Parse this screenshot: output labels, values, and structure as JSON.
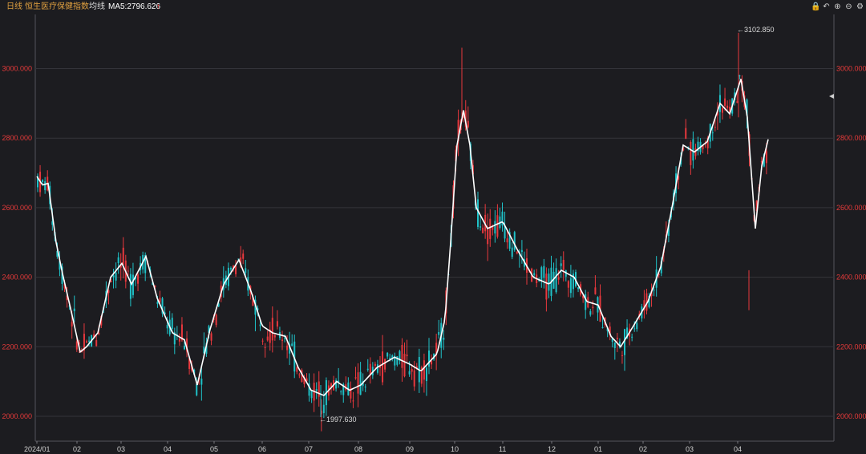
{
  "header": {
    "period_label": "日线",
    "index_name": "恒生医疗保健指数",
    "ma_label": "均线",
    "ma_text": "MA5:2796.626",
    "ma_arrow": "↑"
  },
  "controls": [
    {
      "name": "lock-icon",
      "glyph": "🔒"
    },
    {
      "name": "undo-icon",
      "glyph": "↶"
    },
    {
      "name": "zoom-in-icon",
      "glyph": "⊕"
    },
    {
      "name": "zoom-out-icon",
      "glyph": "⊖"
    },
    {
      "name": "settings-icon",
      "glyph": "⚙"
    }
  ],
  "chart_data": {
    "type": "candlestick",
    "title": "恒生医疗保健指数",
    "ylim": [
      1960,
      3140
    ],
    "y_ticks": [
      2000,
      2200,
      2400,
      2600,
      2800,
      3000
    ],
    "y_tick_labels": [
      "2000.000",
      "2200.000",
      "2400.000",
      "2600.000",
      "2800.000",
      "3000.000"
    ],
    "x_tick_labels": [
      "2024/01",
      "02",
      "03",
      "04",
      "05",
      "06",
      "07",
      "08",
      "09",
      "10",
      "11",
      "12",
      "01",
      "02",
      "03",
      "04"
    ],
    "annotations": [
      {
        "text": "←3102.850",
        "value": 3102.85,
        "kind": "high"
      },
      {
        "text": "←1997.630",
        "value": 1997.63,
        "kind": "low"
      }
    ],
    "ma_line_approx": [
      {
        "month": "2024/01",
        "value": 2690
      },
      {
        "month": "2024/01 end",
        "value": 2190
      },
      {
        "month": "2024/02 end",
        "value": 2450
      },
      {
        "month": "2024/03 end",
        "value": 2230
      },
      {
        "month": "2024/04 end",
        "value": 2090
      },
      {
        "month": "2024/05 end",
        "value": 2450
      },
      {
        "month": "2024/06 end",
        "value": 2240
      },
      {
        "month": "2024/07",
        "value": 2050
      },
      {
        "month": "2024/08 end",
        "value": 2150
      },
      {
        "month": "2024/09 end",
        "value": 2290
      },
      {
        "month": "2024/10 start",
        "value": 2880
      },
      {
        "month": "2024/10 end",
        "value": 2540
      },
      {
        "month": "2024/11 end",
        "value": 2370
      },
      {
        "month": "2024/12 end",
        "value": 2330
      },
      {
        "month": "2025/01",
        "value": 2200
      },
      {
        "month": "2025/02 end",
        "value": 2800
      },
      {
        "month": "2025/03 end",
        "value": 2970
      },
      {
        "month": "2025/04",
        "value": 2540
      },
      {
        "month": "2025/04 latest",
        "value": 2796.626
      }
    ],
    "colors": {
      "up": "#e8383d",
      "down": "#1fc2c8",
      "ma": "#ffffff",
      "axis_label": "#e63a3a",
      "grid": "#34343a",
      "background": "#1c1c20"
    },
    "grid": true
  }
}
